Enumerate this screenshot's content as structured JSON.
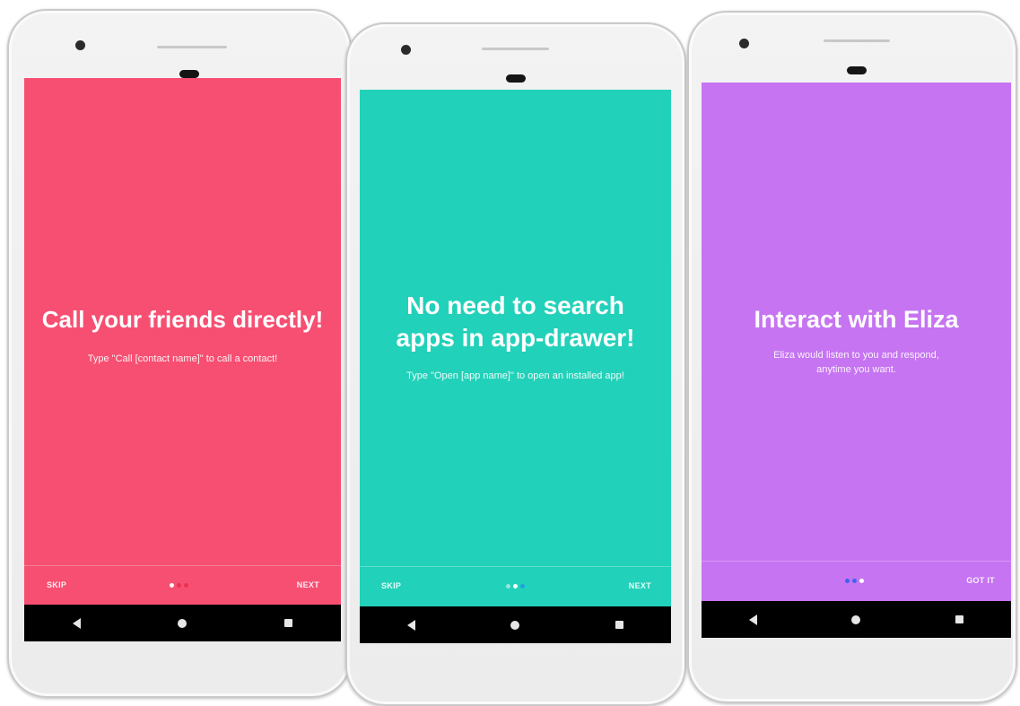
{
  "screens": [
    {
      "title": "Call your friends directly!",
      "description": "Type \"Call [contact name]\" to call a contact!",
      "skip_label": "SKIP",
      "next_label": "NEXT",
      "background_color": "#f64f72",
      "page_indicator": {
        "total": 3,
        "active": 1
      },
      "dot_colors": [
        "#ffffff",
        "#e8334f",
        "#e8334f"
      ]
    },
    {
      "title": "No need to search apps in app-drawer!",
      "description": "Type \"Open [app name]\" to open an installed app!",
      "skip_label": "SKIP",
      "next_label": "NEXT",
      "background_color": "#22d1b9",
      "page_indicator": {
        "total": 3,
        "active": 2
      },
      "dot_colors": [
        "#8fe9de",
        "#ffffff",
        "#1aa3e0"
      ]
    },
    {
      "title": "Interact with Eliza",
      "description": "Eliza would listen to you and respond, anytime you want.",
      "next_label": "GOT IT",
      "background_color": "#c674f2",
      "page_indicator": {
        "total": 3,
        "active": 3
      },
      "dot_colors": [
        "#3b63f0",
        "#3b63f0",
        "#ffffff"
      ]
    }
  ],
  "navigation_bar": {
    "icons": [
      "back-icon",
      "home-icon",
      "recent-apps-icon"
    ]
  }
}
